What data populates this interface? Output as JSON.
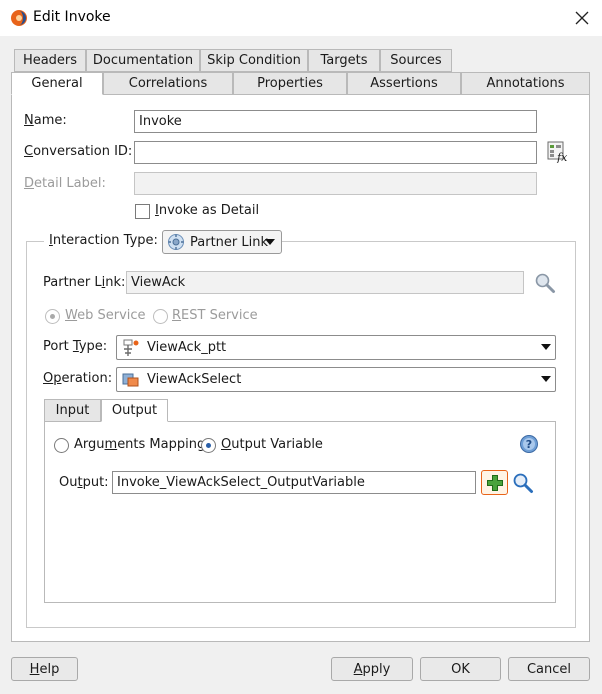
{
  "window": {
    "title": "Edit Invoke",
    "close_glyph": "✕",
    "colors": {
      "accent": "#e8641a",
      "link_icon": "#2a6ebb"
    }
  },
  "tabs_row1": [
    "Headers",
    "Documentation",
    "Skip Condition",
    "Targets",
    "Sources"
  ],
  "tabs_row2": [
    "General",
    "Correlations",
    "Properties",
    "Assertions",
    "Annotations"
  ],
  "active_tab": "General",
  "general": {
    "name_label": [
      "N",
      "ame:"
    ],
    "name_value": "Invoke",
    "conversation_label": [
      "C",
      "onversation ID:"
    ],
    "conversation_value": "",
    "detail_label": [
      "D",
      "etail Label:"
    ],
    "detail_value": "",
    "invoke_detail_label": [
      "I",
      "nvoke as Detail"
    ],
    "interaction_type_label": [
      "I",
      "nteraction Type:"
    ],
    "interaction_type_value": "Partner Link",
    "partner_link_label": [
      "Partner L",
      "i",
      "nk:"
    ],
    "partner_link_value": "ViewAck",
    "web_service_label": [
      "W",
      "eb Service"
    ],
    "rest_service_label": [
      "R",
      "EST Service"
    ],
    "port_type_label": [
      "Port ",
      "T",
      "ype:"
    ],
    "port_type_value": "ViewAck_ptt",
    "operation_label": [
      "O",
      "p",
      "eration:"
    ],
    "operation_value": "ViewAckSelect"
  },
  "subtabs": [
    "Input",
    "Output"
  ],
  "active_subtab": "Output",
  "output": {
    "args_mapping_label": [
      "Argu",
      "m",
      "ents Mapping"
    ],
    "output_variable_label": [
      "O",
      "utput Variable"
    ],
    "output_label": [
      "Ou",
      "t",
      "put:"
    ],
    "output_value": "Invoke_ViewAckSelect_OutputVariable"
  },
  "footer": {
    "help": [
      "H",
      "elp"
    ],
    "apply": [
      "A",
      "pply"
    ],
    "ok": "OK",
    "cancel": "Cancel"
  }
}
